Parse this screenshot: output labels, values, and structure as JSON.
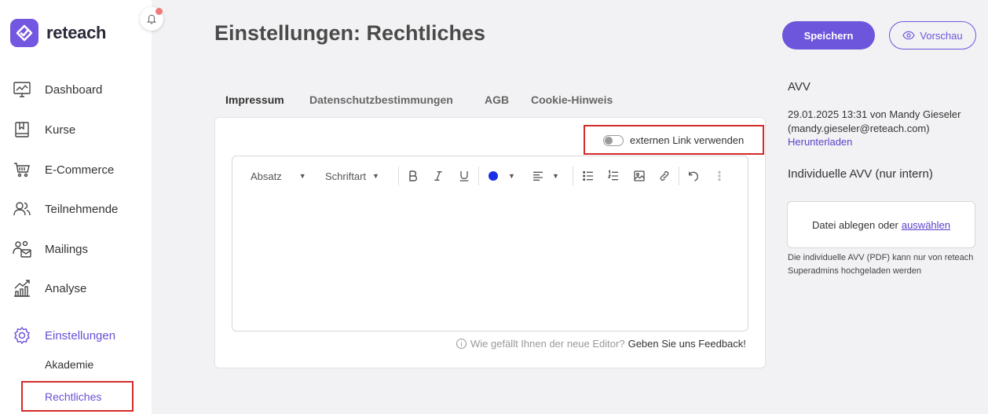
{
  "brand": {
    "name": "reteach",
    "accent": "#6d55dc"
  },
  "nav": {
    "items": [
      {
        "label": "Dashboard",
        "icon": "dashboard-icon"
      },
      {
        "label": "Kurse",
        "icon": "book-icon"
      },
      {
        "label": "E-Commerce",
        "icon": "cart-icon"
      },
      {
        "label": "Teilnehmende",
        "icon": "users-icon"
      },
      {
        "label": "Mailings",
        "icon": "mailings-icon"
      },
      {
        "label": "Analyse",
        "icon": "analytics-icon"
      },
      {
        "label": "Einstellungen",
        "icon": "gear-icon"
      }
    ],
    "sub": [
      {
        "label": "Akademie"
      },
      {
        "label": "Rechtliches"
      }
    ]
  },
  "header": {
    "title": "Einstellungen: Rechtliches",
    "save_label": "Speichern",
    "preview_label": "Vorschau"
  },
  "tabs": [
    {
      "label": "Impressum"
    },
    {
      "label": "Datenschutzbestimmungen"
    },
    {
      "label": "AGB"
    },
    {
      "label": "Cookie-Hinweis"
    }
  ],
  "editor": {
    "external_link_label": "externen Link verwenden",
    "paragraph_label": "Absatz",
    "font_label": "Schriftart",
    "text_color": "#1a2fe6",
    "feedback_question": "Wie gefällt Ihnen der neue Editor?",
    "feedback_link": "Geben Sie uns Feedback!"
  },
  "right_panel": {
    "avv_title": "AVV",
    "avv_line1": "29.01.2025 13:31 von Mandy Gieseler",
    "avv_line2": "(mandy.gieseler@reteach.com)",
    "avv_download": "Herunterladen",
    "individual_title": "Individuelle AVV (nur intern)",
    "drop_text": "Datei ablegen oder",
    "drop_link": "auswählen",
    "drop_note": "Die individuelle AVV (PDF) kann nur von reteach Superadmins hochgeladen werden"
  }
}
